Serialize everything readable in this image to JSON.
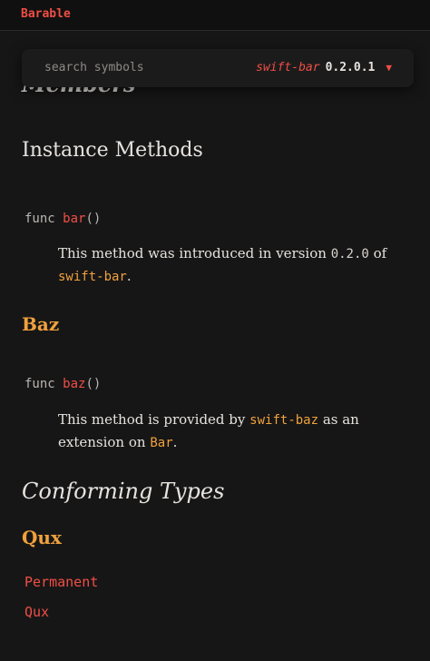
{
  "app": {
    "brand": "Barable"
  },
  "search": {
    "placeholder": "search symbols",
    "package": "swift-bar",
    "version": "0.2.0.1",
    "chevron_icon": "triangle-down-icon"
  },
  "content": {
    "clipped_heading": "Members",
    "instance_methods_heading": "Instance Methods",
    "method_bar": {
      "keyword": "func",
      "name": "bar",
      "parens": "()",
      "desc_prefix": "This method was introduced in version",
      "desc_version": "0.2.0",
      "desc_of": "of",
      "desc_package": "swift-bar",
      "desc_end": "."
    },
    "baz_heading": "Baz",
    "method_baz": {
      "keyword": "func",
      "name": "baz",
      "parens": "()",
      "desc_prefix": "This method is provided by",
      "desc_package": "swift-baz",
      "desc_middle": "as an extension on",
      "desc_type": "Bar",
      "desc_end": "."
    },
    "conforming_types_heading": "Conforming Types",
    "qux_heading": "Qux",
    "links": [
      "Permanent",
      "Qux"
    ]
  },
  "colors": {
    "background": "#171617",
    "accent_red": "#ef4f44",
    "accent_orange": "#f0a23c",
    "text": "#e6e3de"
  }
}
